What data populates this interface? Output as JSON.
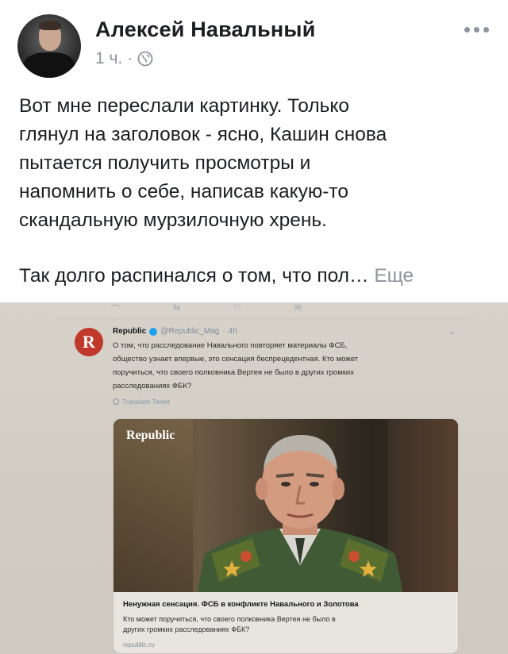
{
  "post": {
    "author": "Алексей Навальный",
    "time": "1 ч.",
    "separator": "·",
    "audience_icon": "globe-icon",
    "paragraph1": "Вот мне переслали картинку. Только\nглянул на заголовок - ясно, Кашин снова\nпытается получить просмотры и\nнапомнить о себе, написав какую-то\nскандальную мурзилочную хрень.",
    "paragraph2": "Так долго распинался о том, что пол…",
    "see_more": "Еще"
  },
  "tweet": {
    "logo_letter": "R",
    "name": "Republic",
    "handle": "@Republic_Mag",
    "time": "4h",
    "text": "О том, что расследование Навального повторяет материалы ФСБ,\nобщество узнает впервые, это сенсация беспрецедентная. Кто может\nпоручиться, что своего полковника Вертея не было в других громких\nрасследованиях ФБК?",
    "translate": "Translate Tweet",
    "card": {
      "brand": "Republic",
      "title": "Ненужная сенсация. ФСБ в конфликте Навального и Золотова",
      "description": "Кто может поручиться, что своего полковника Вертея не было в\nдругих громких расследованиях ФБК?",
      "domain": "republic.ru"
    }
  },
  "colors": {
    "text": "#1c1e21",
    "meta": "#90949c",
    "republic_red": "#c0392b"
  }
}
